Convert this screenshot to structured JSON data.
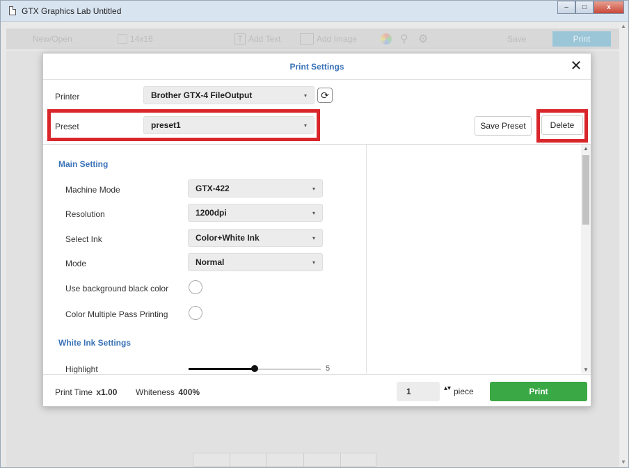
{
  "window": {
    "title": "GTX Graphics Lab Untitled",
    "minimize_glyph": "–",
    "maximize_glyph": "□",
    "close_glyph": "x"
  },
  "toolbar": {
    "new_open": "New/Open",
    "size": "14x16",
    "add_text": "Add Text",
    "add_image": "Add Image",
    "save": "Save",
    "print": "Print"
  },
  "dialog": {
    "title": "Print Settings",
    "close_glyph": "✕",
    "printer_label": "Printer",
    "printer_value": "Brother GTX-4 FileOutput",
    "preset_label": "Preset",
    "preset_value": "preset1",
    "save_preset": "Save Preset",
    "delete": "Delete",
    "caret": "▾",
    "refresh_glyph": "⟳"
  },
  "main_setting": {
    "title": "Main Setting",
    "rows": [
      {
        "label": "Machine Mode",
        "value": "GTX-422"
      },
      {
        "label": "Resolution",
        "value": "1200dpi"
      },
      {
        "label": "Select Ink",
        "value": "Color+White Ink"
      },
      {
        "label": "Mode",
        "value": "Normal"
      }
    ],
    "toggles": [
      {
        "label": "Use background black color"
      },
      {
        "label": "Color Multiple Pass Printing"
      }
    ]
  },
  "white_ink": {
    "title": "White Ink Settings",
    "highlight_label": "Highlight",
    "highlight_value": "5",
    "highlight_fraction": 0.5
  },
  "footer": {
    "print_time_label": "Print Time",
    "print_time_value": "x1.00",
    "whiteness_label": "Whiteness",
    "whiteness_value": "400%",
    "quantity": "1",
    "spin_glyph": "▴▾",
    "piece": "piece",
    "print": "Print"
  },
  "colors": {
    "accent": "#3a73b8",
    "print_green": "#3aa845",
    "highlight_red": "#d9262b"
  }
}
